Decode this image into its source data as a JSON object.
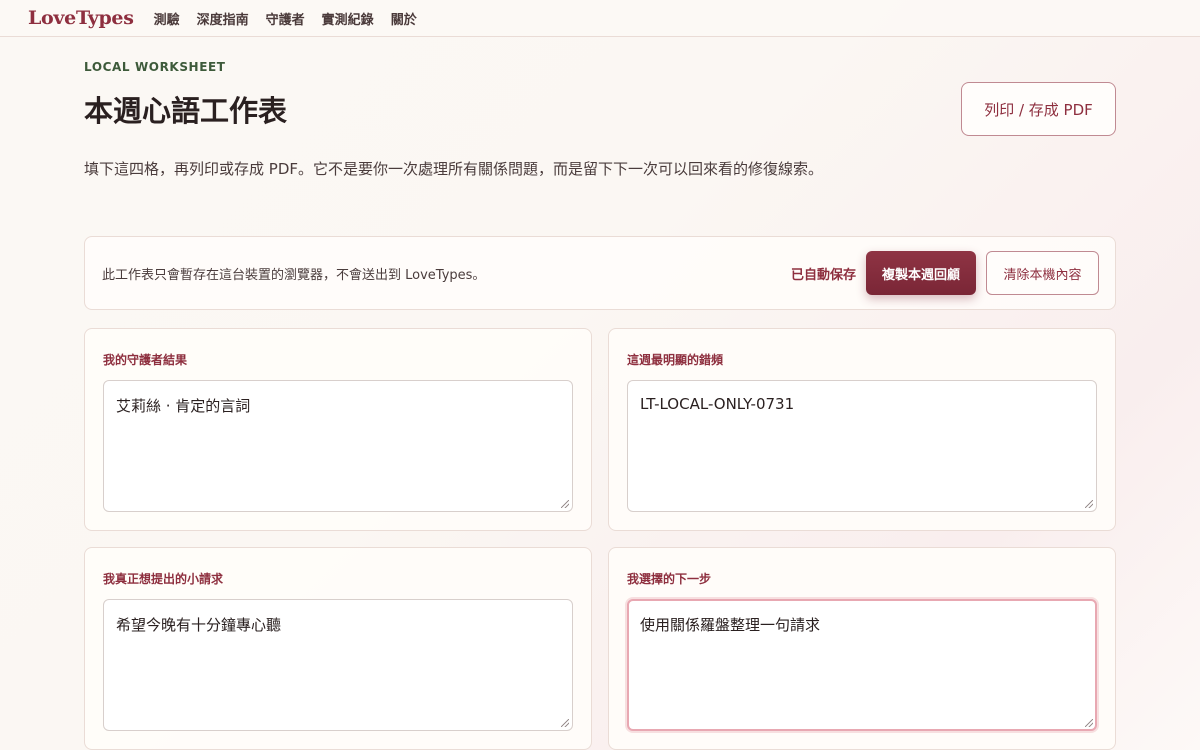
{
  "nav": {
    "brand": "LoveTypes",
    "links": [
      "測驗",
      "深度指南",
      "守護者",
      "實測紀錄",
      "關於"
    ]
  },
  "header": {
    "eyebrow": "LOCAL WORKSHEET",
    "title": "本週心語工作表",
    "print_button": "列印 / 存成 PDF",
    "intro": "填下這四格，再列印或存成 PDF。它不是要你一次處理所有關係問題，而是留下下一次可以回來看的修復線索。"
  },
  "notice": {
    "text": "此工作表只會暫存在這台裝置的瀏覽器，不會送出到 LoveTypes。",
    "saved_status": "已自動保存",
    "copy_button": "複製本週回顧",
    "clear_button": "清除本機內容"
  },
  "cards": [
    {
      "label": "我的守護者結果",
      "value": "艾莉絲 · 肯定的言詞"
    },
    {
      "label": "這週最明顯的錯頻",
      "value": "LT-LOCAL-ONLY-0731"
    },
    {
      "label": "我真正想提出的小請求",
      "value": "希望今晚有十分鐘專心聽"
    },
    {
      "label": "我選擇的下一步",
      "value": "使用關係羅盤整理一句請求"
    }
  ],
  "colors": {
    "accent": "#8e2f3f",
    "eyebrow": "#3d5a3a",
    "focus_ring": "#e8a8b2"
  }
}
